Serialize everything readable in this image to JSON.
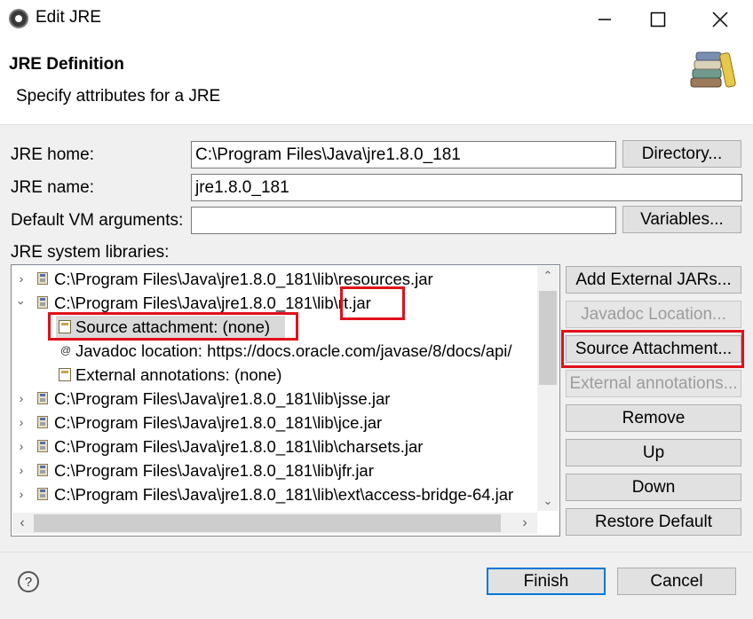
{
  "window": {
    "title": "Edit JRE"
  },
  "header": {
    "title": "JRE Definition",
    "subtitle": "Specify attributes for a JRE"
  },
  "form": {
    "jre_home_label": "JRE home:",
    "jre_home_value": "C:\\Program Files\\Java\\jre1.8.0_181",
    "directory_button": "Directory...",
    "jre_name_label": "JRE name:",
    "jre_name_value": "jre1.8.0_181",
    "vm_args_label": "Default VM arguments:",
    "vm_args_value": "",
    "variables_button": "Variables...",
    "libraries_label": "JRE system libraries:"
  },
  "tree": {
    "rows": [
      {
        "prefix": "C:\\Program Files\\Java\\jre1.8.0_181\\lib\\",
        "name": "resources.jar"
      },
      {
        "prefix": "C:\\Program Files\\Java\\jre1.8.0_181\\lib\\",
        "name": "rt.jar"
      },
      {
        "text": "Source attachment: (none)"
      },
      {
        "text": "Javadoc location: https://docs.oracle.com/javase/8/docs/api/"
      },
      {
        "text": "External annotations: (none)"
      },
      {
        "prefix": "C:\\Program Files\\Java\\jre1.8.0_181\\lib\\",
        "name": "jsse.jar"
      },
      {
        "prefix": "C:\\Program Files\\Java\\jre1.8.0_181\\lib\\",
        "name": "jce.jar"
      },
      {
        "prefix": "C:\\Program Files\\Java\\jre1.8.0_181\\lib\\",
        "name": "charsets.jar"
      },
      {
        "prefix": "C:\\Program Files\\Java\\jre1.8.0_181\\lib\\",
        "name": "jfr.jar"
      },
      {
        "prefix": "C:\\Program Files\\Java\\jre1.8.0_181\\lib\\",
        "name": "ext\\access-bridge-64.jar"
      }
    ]
  },
  "side_buttons": {
    "add_external_jars": "Add External JARs...",
    "javadoc_location": "Javadoc Location...",
    "source_attachment": "Source Attachment...",
    "external_annotations": "External annotations...",
    "remove": "Remove",
    "up": "Up",
    "down": "Down",
    "restore_default": "Restore Default"
  },
  "footer": {
    "finish": "Finish",
    "cancel": "Cancel"
  },
  "colors": {
    "highlight": "#e0101a",
    "accent": "#0078d7"
  },
  "icons": [
    "eclipse-icon",
    "minimize-icon",
    "maximize-icon",
    "close-icon",
    "books-icon",
    "jar-icon",
    "source-attachment-icon",
    "javadoc-icon",
    "annotations-icon",
    "help-icon"
  ]
}
